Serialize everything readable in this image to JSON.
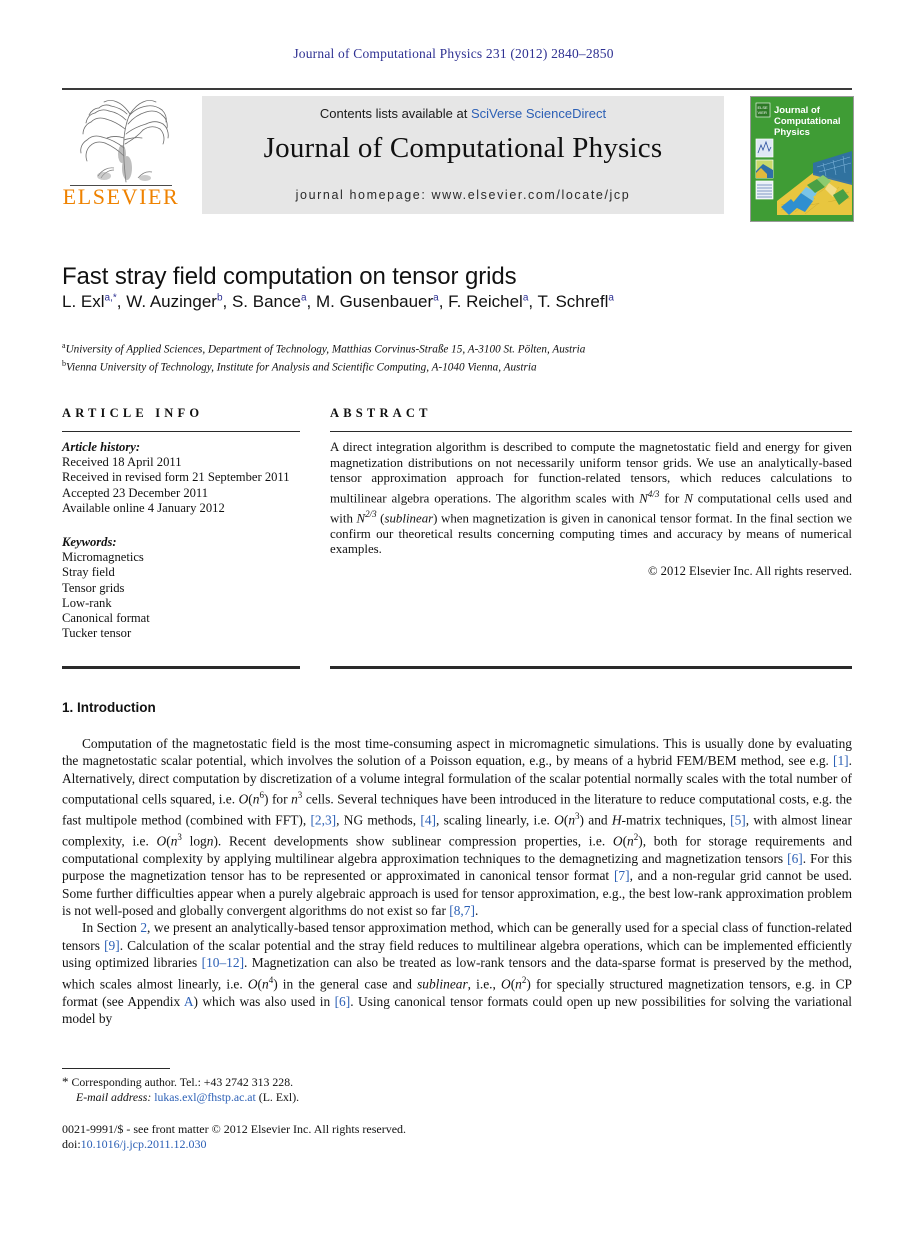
{
  "running_head": "Journal of Computational Physics 231 (2012) 2840–2850",
  "masthead": {
    "contents_prefix": "Contents lists available at ",
    "contents_link": "SciVerse ScienceDirect",
    "journal_title": "Journal of Computational Physics",
    "homepage": "journal homepage: www.elsevier.com/locate/jcp",
    "publisher_name": "ELSEVIER",
    "cover_title_lines": [
      "Journal of",
      "Computational",
      "Physics"
    ]
  },
  "article": {
    "title": "Fast stray field computation on tensor grids",
    "authors": [
      {
        "name": "L. Exl",
        "sup": "a,*"
      },
      {
        "name": "W. Auzinger",
        "sup": "b"
      },
      {
        "name": "S. Bance",
        "sup": "a"
      },
      {
        "name": "M. Gusenbauer",
        "sup": "a"
      },
      {
        "name": "F. Reichel",
        "sup": "a"
      },
      {
        "name": "T. Schrefl",
        "sup": "a"
      }
    ],
    "affiliations": [
      {
        "marker": "a",
        "text": "University of Applied Sciences, Department of Technology, Matthias Corvinus-Straße 15, A-3100 St. Pölten, Austria"
      },
      {
        "marker": "b",
        "text": "Vienna University of Technology, Institute for Analysis and Scientific Computing, A-1040 Vienna, Austria"
      }
    ]
  },
  "article_info": {
    "heading": "ARTICLE INFO",
    "history_label": "Article history:",
    "history": [
      "Received 18 April 2011",
      "Received in revised form 21 September 2011",
      "Accepted 23 December 2011",
      "Available online 4 January 2012"
    ],
    "keywords_label": "Keywords:",
    "keywords": [
      "Micromagnetics",
      "Stray field",
      "Tensor grids",
      "Low-rank",
      "Canonical format",
      "Tucker tensor"
    ]
  },
  "abstract": {
    "heading": "ABSTRACT",
    "copyright": "© 2012 Elsevier Inc. All rights reserved."
  },
  "body": {
    "section_heading": "1. Introduction"
  },
  "footnote": {
    "corresponding": "Corresponding author. Tel.: +43 2742 313 228.",
    "email_label": "E-mail address:",
    "email": "lukas.exl@fhstp.ac.at",
    "email_owner": "(L. Exl).",
    "imprint": "0021-9991/$ - see front matter © 2012 Elsevier Inc. All rights reserved.",
    "doi_label": "doi:",
    "doi": "10.1016/j.jcp.2011.12.030"
  },
  "colors": {
    "link": "#2b5fb5",
    "running_head": "#2e3192",
    "elsevier_orange": "#ef8200",
    "cover_green": "#3f9c35"
  }
}
